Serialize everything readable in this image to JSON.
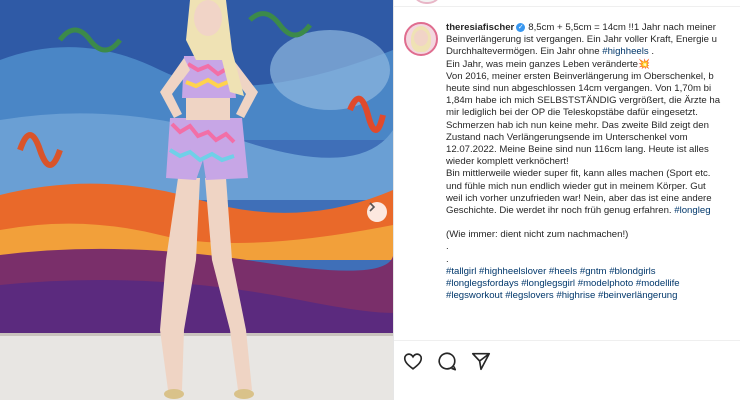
{
  "post": {
    "username": "theresiafischer",
    "caption_lines": [
      {
        "text": "8,5cm + 5,5cm = 14cm !!1 Jahr nach meiner",
        "first": true
      },
      {
        "text": "Beinverlängerung ist vergangen. Ein Jahr voller Kraft, Energie u"
      },
      {
        "text": "Durchhaltevermögen. Ein Jahr ohne ",
        "tag": "#highheels",
        "after": " ."
      },
      {
        "text": "Ein Jahr, was mein ganzes Leben veränderte💥"
      },
      {
        "text": "Von 2016, meiner ersten Beinverlängerung im Oberschenkel, b"
      },
      {
        "text": "heute sind nun abgeschlossen 14cm vergangen. Von 1,70m bi"
      },
      {
        "text": "1,84m habe ich mich SELBSTSTÄNDIG vergrößert, die Ärzte ha"
      },
      {
        "text": "mir lediglich bei der OP die Teleskopstäbe dafür eingesetzt."
      },
      {
        "text": "Schmerzen hab ich nun keine mehr. Das zweite Bild zeigt den"
      },
      {
        "text": "Zustand nach Verlängerungsende im Unterschenkel vom"
      },
      {
        "text": "12.07.2022. Meine Beine sind nun 116cm lang. Heute ist alles"
      },
      {
        "text": "wieder komplett verknöchert!"
      },
      {
        "text": "Bin mittlerweile wieder super fit, kann alles machen (Sport etc."
      },
      {
        "text": "und fühle mich nun endlich wieder gut in meinem Körper. Gut"
      },
      {
        "text": "weil ich vorher unzufrieden war! Nein, aber das ist eine andere"
      },
      {
        "text": "Geschichte. Die werdet ihr noch früh genug erfahren. ",
        "tag": "#longleg"
      },
      {
        "text": ""
      },
      {
        "text": "(Wie immer: dient nicht zum nachmachen!)"
      },
      {
        "text": "."
      },
      {
        "text": "."
      },
      {
        "text": "",
        "tag": "#tallgirl #highheelslover #heels #gntm #blondgirls"
      },
      {
        "text": "",
        "tag": "#longlegsfordays #longlegsgirl #modelphoto #modellife"
      },
      {
        "text": "",
        "tag": "#legsworkout #legslovers #highrise #beinverlängerung"
      }
    ]
  },
  "icons": {
    "like": "heart-icon",
    "comment": "comment-icon",
    "share": "share-icon",
    "next": "chevron-right-icon",
    "verified": "verified-badge-icon"
  },
  "colors": {
    "hashtag": "#00376b",
    "verified": "#3897f0",
    "text": "#262626"
  }
}
